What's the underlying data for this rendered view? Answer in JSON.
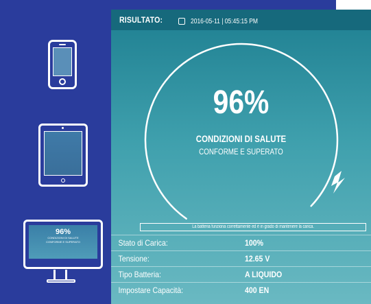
{
  "devices": {
    "monitor_value": "96%",
    "monitor_line1": "CONDIZIONI DI SALUTE",
    "monitor_line2": "CONFORME E SUPERATO"
  },
  "header": {
    "title": "RISULTATO:",
    "timestamp": "2016-05-11 | 05:45:15 PM"
  },
  "gauge": {
    "percent": "96%",
    "percent_value": 96,
    "condition": "CONDIZIONI DI SALUTE",
    "status": "CONFORME E SUPERATO"
  },
  "note": "La batteria funziona correttamente ed è in grado di mantenere la carica.",
  "details": [
    {
      "label": "Stato di Carica:",
      "value": "100%"
    },
    {
      "label": "Tensione:",
      "value": "12.65 V"
    },
    {
      "label": "Tipo Batteria:",
      "value": "A LIQUIDO"
    },
    {
      "label": "Impostare Capacità:",
      "value": "400 EN"
    }
  ],
  "colors": {
    "background": "#2a3c9c",
    "header": "#16697c",
    "panel_top": "#1e7f91",
    "panel_bottom": "#6ab9c2"
  }
}
